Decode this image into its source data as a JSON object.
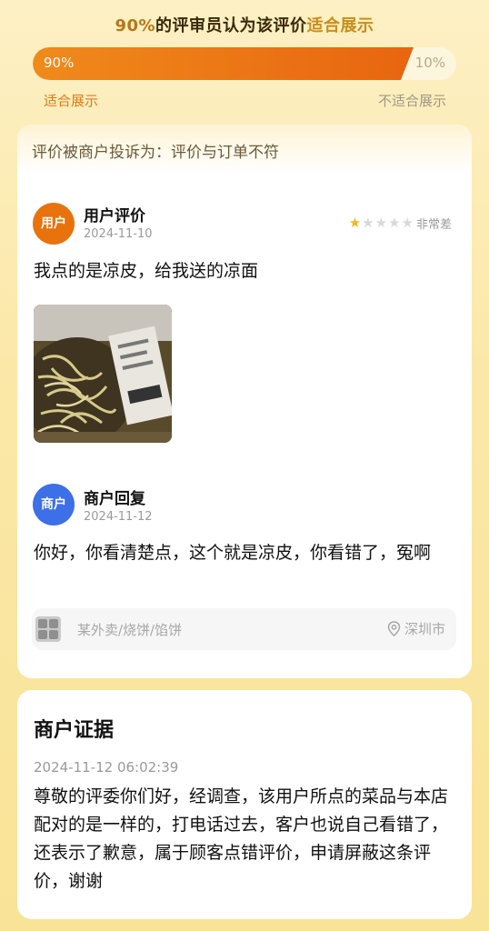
{
  "header": {
    "percent": "90%",
    "text_mid": "的评审员认为该评价",
    "text_accent": "适合展示"
  },
  "vote_bar": {
    "suitable_pct": "90%",
    "unsuitable_pct": "10%",
    "suitable_fraction": 0.9,
    "suitable_label": "适合展示",
    "unsuitable_label": "不适合展示"
  },
  "review_card": {
    "complaint": "评价被商户投诉为：评价与订单不符",
    "user_review": {
      "avatar_text": "用户",
      "title": "用户评价",
      "date": "2024-11-10",
      "stars": 1,
      "max_stars": 5,
      "rating_label": "非常差",
      "text": "我点的是凉皮，给我送的凉面"
    },
    "merchant_reply": {
      "avatar_text": "商户",
      "title": "商户回复",
      "date": "2024-11-12",
      "text": "你好，你看清楚点，这个就是凉皮，你看错了，冤啊"
    },
    "shop": {
      "category": "某外卖/烧饼/馅饼",
      "city": "深圳市"
    }
  },
  "evidence_card": {
    "title": "商户证据",
    "datetime": "2024-11-12 06:02:39",
    "text": "尊敬的评委你们好，经调查，该用户所点的菜品与本店配对的是一样的，打电话过去，客户也说自己看错了，还表示了歉意，属于顾客点错评价，申请屏蔽这条评价，谢谢"
  },
  "colors": {
    "accent_orange": "#e8720c",
    "merchant_blue": "#3c6fe8",
    "star_gold": "#f2b61e"
  }
}
